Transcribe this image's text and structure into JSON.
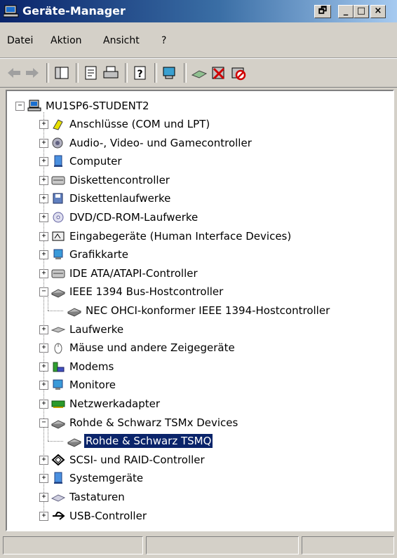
{
  "window": {
    "title": "Geräte-Manager",
    "buttons": {
      "restore": "🗗",
      "minimize": "_",
      "maximize": "□",
      "close": "×"
    }
  },
  "menu": [
    "Datei",
    "Aktion",
    "Ansicht",
    "?"
  ],
  "toolbar": {
    "tools": [
      "back-arrow-icon",
      "forward-arrow-icon",
      "console-tree-icon",
      "properties-icon",
      "print-icon",
      "help-icon",
      "scan-hardware-icon",
      "update-driver-icon",
      "uninstall-icon",
      "disable-icon"
    ]
  },
  "tree": {
    "root": "MU1SP6-STUDENT2",
    "items": [
      {
        "label": "Anschlüsse (COM und LPT)",
        "icon": "port-icon",
        "expander": "+"
      },
      {
        "label": "Audio-, Video- und Gamecontroller",
        "icon": "audio-icon",
        "expander": "+"
      },
      {
        "label": "Computer",
        "icon": "computer-icon",
        "expander": "+"
      },
      {
        "label": "Diskettencontroller",
        "icon": "floppy-controller-icon",
        "expander": "+"
      },
      {
        "label": "Diskettenlaufwerke",
        "icon": "floppy-drive-icon",
        "expander": "+"
      },
      {
        "label": "DVD/CD-ROM-Laufwerke",
        "icon": "cdrom-icon",
        "expander": "+"
      },
      {
        "label": "Eingabegeräte (Human Interface Devices)",
        "icon": "hid-icon",
        "expander": "+"
      },
      {
        "label": "Grafikkarte",
        "icon": "display-adapter-icon",
        "expander": "+"
      },
      {
        "label": "IDE ATA/ATAPI-Controller",
        "icon": "ide-controller-icon",
        "expander": "+"
      },
      {
        "label": "IEEE 1394 Bus-Hostcontroller",
        "icon": "ieee1394-icon",
        "expander": "−"
      },
      {
        "label": "NEC OHCI-konformer IEEE 1394-Hostcontroller",
        "icon": "ieee1394-icon",
        "child": true
      },
      {
        "label": "Laufwerke",
        "icon": "disk-drive-icon",
        "expander": "+"
      },
      {
        "label": "Mäuse und andere Zeigegeräte",
        "icon": "mouse-icon",
        "expander": "+"
      },
      {
        "label": "Modems",
        "icon": "modem-icon",
        "expander": "+"
      },
      {
        "label": "Monitore",
        "icon": "monitor-icon",
        "expander": "+"
      },
      {
        "label": "Netzwerkadapter",
        "icon": "network-adapter-icon",
        "expander": "+"
      },
      {
        "label": "Rohde & Schwarz TSMx Devices",
        "icon": "ieee1394-icon",
        "expander": "−"
      },
      {
        "label": "Rohde & Schwarz TSMQ",
        "icon": "ieee1394-icon",
        "child": true,
        "selected": true
      },
      {
        "label": "SCSI- und RAID-Controller",
        "icon": "scsi-icon",
        "expander": "+"
      },
      {
        "label": "Systemgeräte",
        "icon": "system-device-icon",
        "expander": "+"
      },
      {
        "label": "Tastaturen",
        "icon": "keyboard-icon",
        "expander": "+"
      },
      {
        "label": "USB-Controller",
        "icon": "usb-icon",
        "expander": "+"
      }
    ]
  },
  "status": {
    "panes": [
      "",
      "",
      ""
    ]
  },
  "colors": {
    "selection": "#0a246a",
    "titlebar": "#0a246a",
    "chrome": "#d4d0c8"
  }
}
